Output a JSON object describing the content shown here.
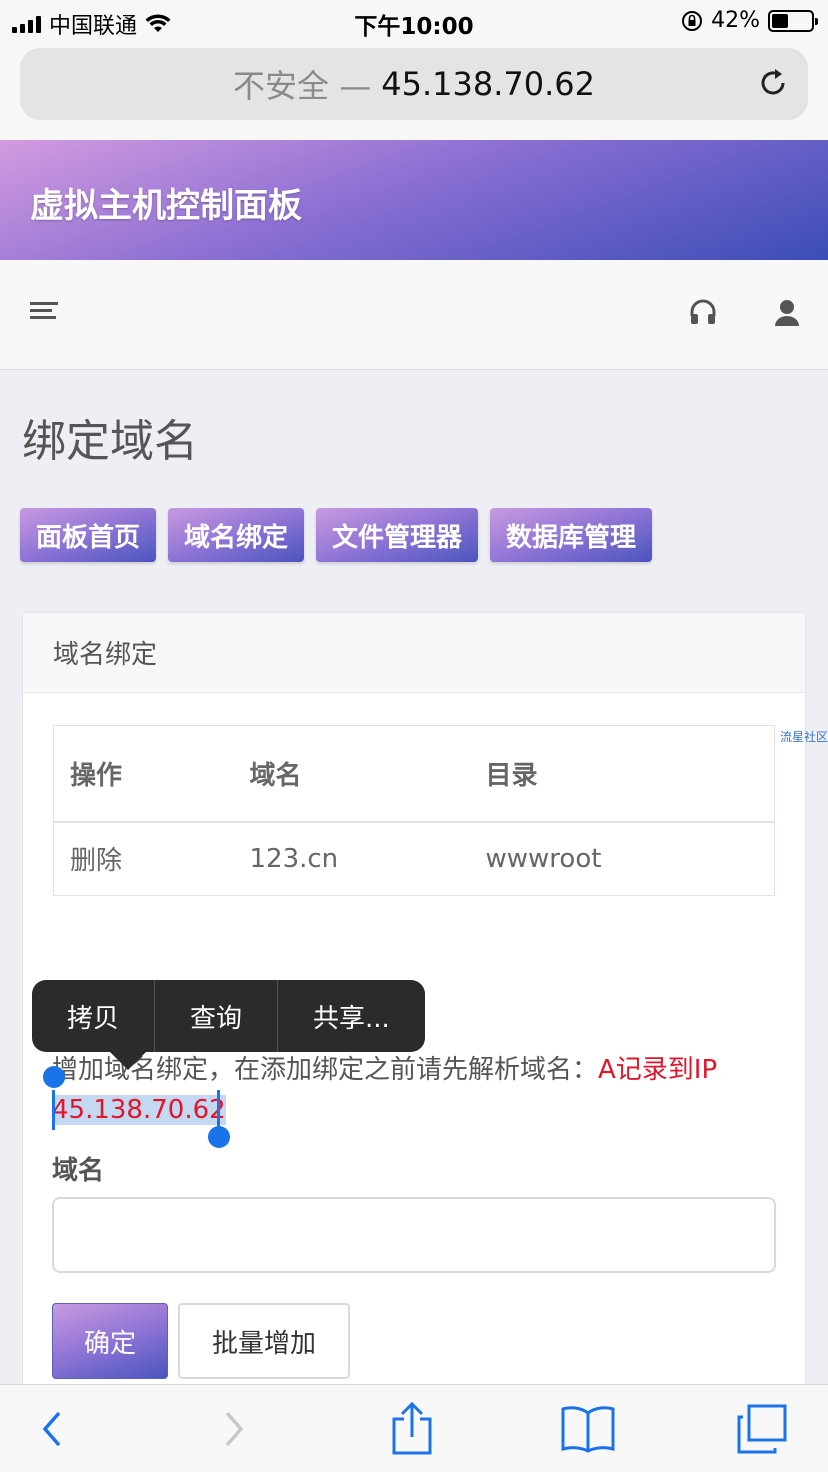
{
  "status_bar": {
    "carrier": "中国联通",
    "time": "下午10:00",
    "battery_percent": "42%",
    "battery_level": 0.42
  },
  "browser": {
    "insecure_label": "不安全 —",
    "host": "45.138.70.62"
  },
  "header": {
    "title": "虚拟主机控制面板"
  },
  "page": {
    "title": "绑定域名",
    "tabs": [
      "面板首页",
      "域名绑定",
      "文件管理器",
      "数据库管理"
    ]
  },
  "card": {
    "title": "域名绑定",
    "table": {
      "headers": [
        "操作",
        "域名",
        "目录"
      ],
      "rows": [
        [
          "删除",
          "123.cn",
          "wwwroot"
        ]
      ]
    },
    "hint_text": "增加域名绑定，在添加绑定之前请先解析域名：",
    "hint_highlight": "A记录到IP",
    "hint_selected": "45.138.70.62",
    "field_label": "域名",
    "field_value": "",
    "confirm_label": "确定",
    "bulk_add_label": "批量增加"
  },
  "context_menu": {
    "items": [
      "拷贝",
      "查询",
      "共享..."
    ]
  },
  "watermark": "流星社区",
  "colors": {
    "accent_gradient": [
      "#d39be0",
      "#8b6fd3",
      "#3c4db7"
    ],
    "ios_blue": "#1a73e8",
    "hint_red": "#e0162b"
  }
}
